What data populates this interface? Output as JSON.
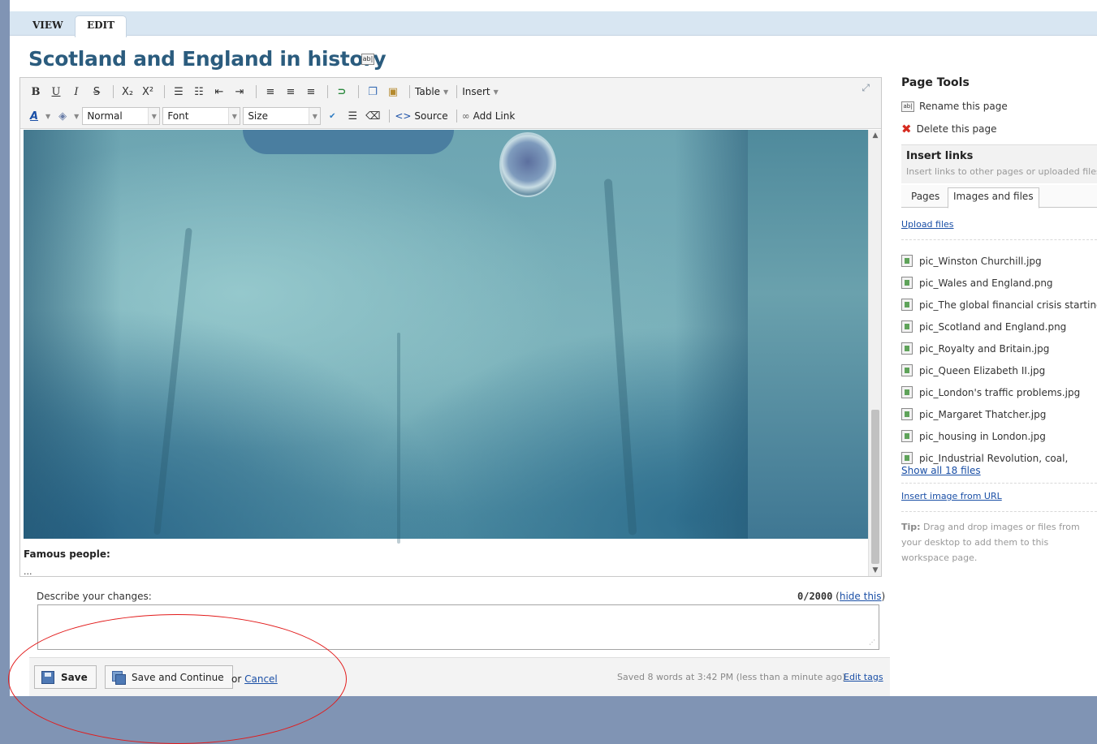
{
  "tabs": {
    "view": "VIEW",
    "edit": "EDIT"
  },
  "page": {
    "title": "Scotland and England in history"
  },
  "toolbar": {
    "bold": "B",
    "underline": "U",
    "italic": "I",
    "strike": "S",
    "subscript": "X₂",
    "superscript": "X²",
    "table": "Table",
    "insert": "Insert",
    "format_value": "Normal",
    "font_value": "Font",
    "size_value": "Size",
    "source": "Source",
    "add_link": "Add Link"
  },
  "content": {
    "famous": "Famous people:",
    "ellipsis": "..."
  },
  "describe": {
    "label": "Describe your changes:",
    "count": "0/2000",
    "hide": "hide this",
    "value": ""
  },
  "actions": {
    "save": "Save",
    "save_continue": "Save and Continue",
    "or": "or",
    "cancel": "Cancel",
    "status": "Saved 8 words at 3:42 PM (less than a minute ago)",
    "edit_tags": "Edit tags"
  },
  "sidebar": {
    "page_tools": "Page Tools",
    "rename": "Rename this page",
    "delete": "Delete this page",
    "insert_links": "Insert links",
    "insert_sub": "Insert links to other pages or uploaded files.",
    "tab_pages": "Pages",
    "tab_images": "Images and files",
    "upload": "Upload files",
    "files": [
      "pic_Winston Churchill.jpg",
      "pic_Wales and England.png",
      "pic_The global financial crisis starting",
      "pic_Scotland and England.png",
      "pic_Royalty and Britain.jpg",
      "pic_Queen Elizabeth II.jpg",
      "pic_London's traffic problems.jpg",
      "pic_Margaret Thatcher.jpg",
      "pic_housing in London.jpg",
      "pic_Industrial Revolution, coal,"
    ],
    "show_all": "Show all 18 files",
    "insert_url": "Insert image from URL",
    "tip_label": "Tip:",
    "tip_text": "Drag and drop images or files from your desktop to add them to this workspace page."
  }
}
